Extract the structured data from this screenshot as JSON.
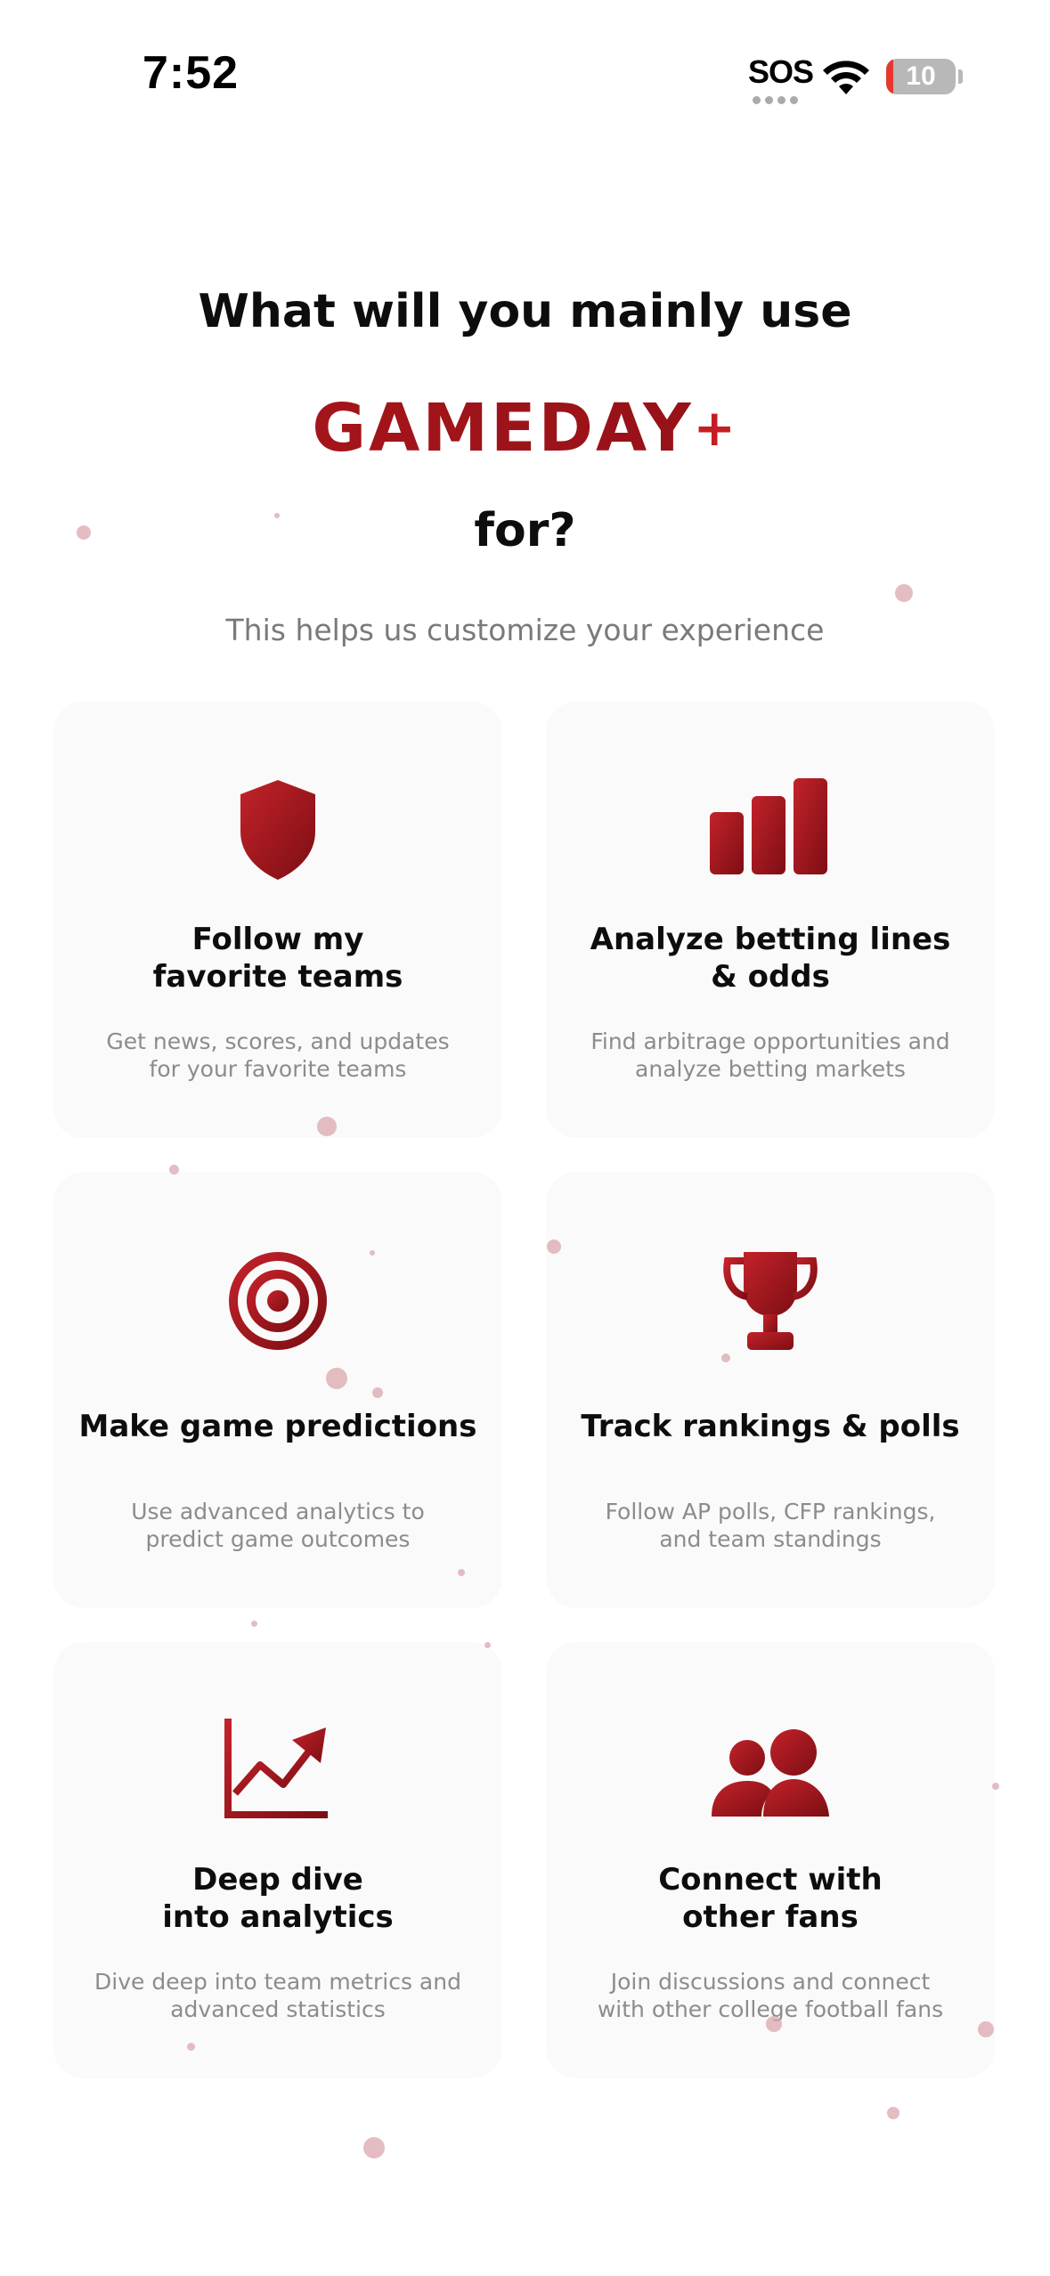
{
  "status_bar": {
    "time": "7:52",
    "sos": "SOS",
    "battery_level": "10",
    "battery_percent": 10,
    "wifi_icon": "wifi-icon",
    "battery_icon": "battery-icon"
  },
  "header": {
    "line1": "What will you mainly use",
    "brand": "GAMEDAY",
    "brand_plus": "+",
    "line2": "for?",
    "subtitle": "This helps us customize your experience"
  },
  "options": [
    {
      "icon": "shield-icon",
      "title_line1": "Follow my",
      "title_line2": "favorite teams",
      "desc_line1": "Get news, scores, and updates",
      "desc_line2": "for your favorite teams"
    },
    {
      "icon": "bar-chart-icon",
      "title_line1": "Analyze betting lines",
      "title_line2": "& odds",
      "desc_line1": "Find arbitrage opportunities and",
      "desc_line2": "analyze betting markets"
    },
    {
      "icon": "target-icon",
      "title_line1": "Make game predictions",
      "title_line2": "",
      "desc_line1": "Use advanced analytics to",
      "desc_line2": "predict game outcomes"
    },
    {
      "icon": "trophy-icon",
      "title_line1": "Track rankings & polls",
      "title_line2": "",
      "desc_line1": "Follow AP polls, CFP rankings,",
      "desc_line2": "and team standings"
    },
    {
      "icon": "trending-up-icon",
      "title_line1": "Deep dive",
      "title_line2": "into analytics",
      "desc_line1": "Dive deep into team metrics and",
      "desc_line2": "advanced statistics"
    },
    {
      "icon": "users-icon",
      "title_line1": "Connect with",
      "title_line2": "other fans",
      "desc_line1": "Join discussions and connect",
      "desc_line2": "with other college football fans"
    }
  ],
  "colors": {
    "accent": "#9e1a20",
    "accent_light": "#c41e24",
    "card_bg": "#fafafa",
    "muted_text": "#8c8c8c"
  }
}
